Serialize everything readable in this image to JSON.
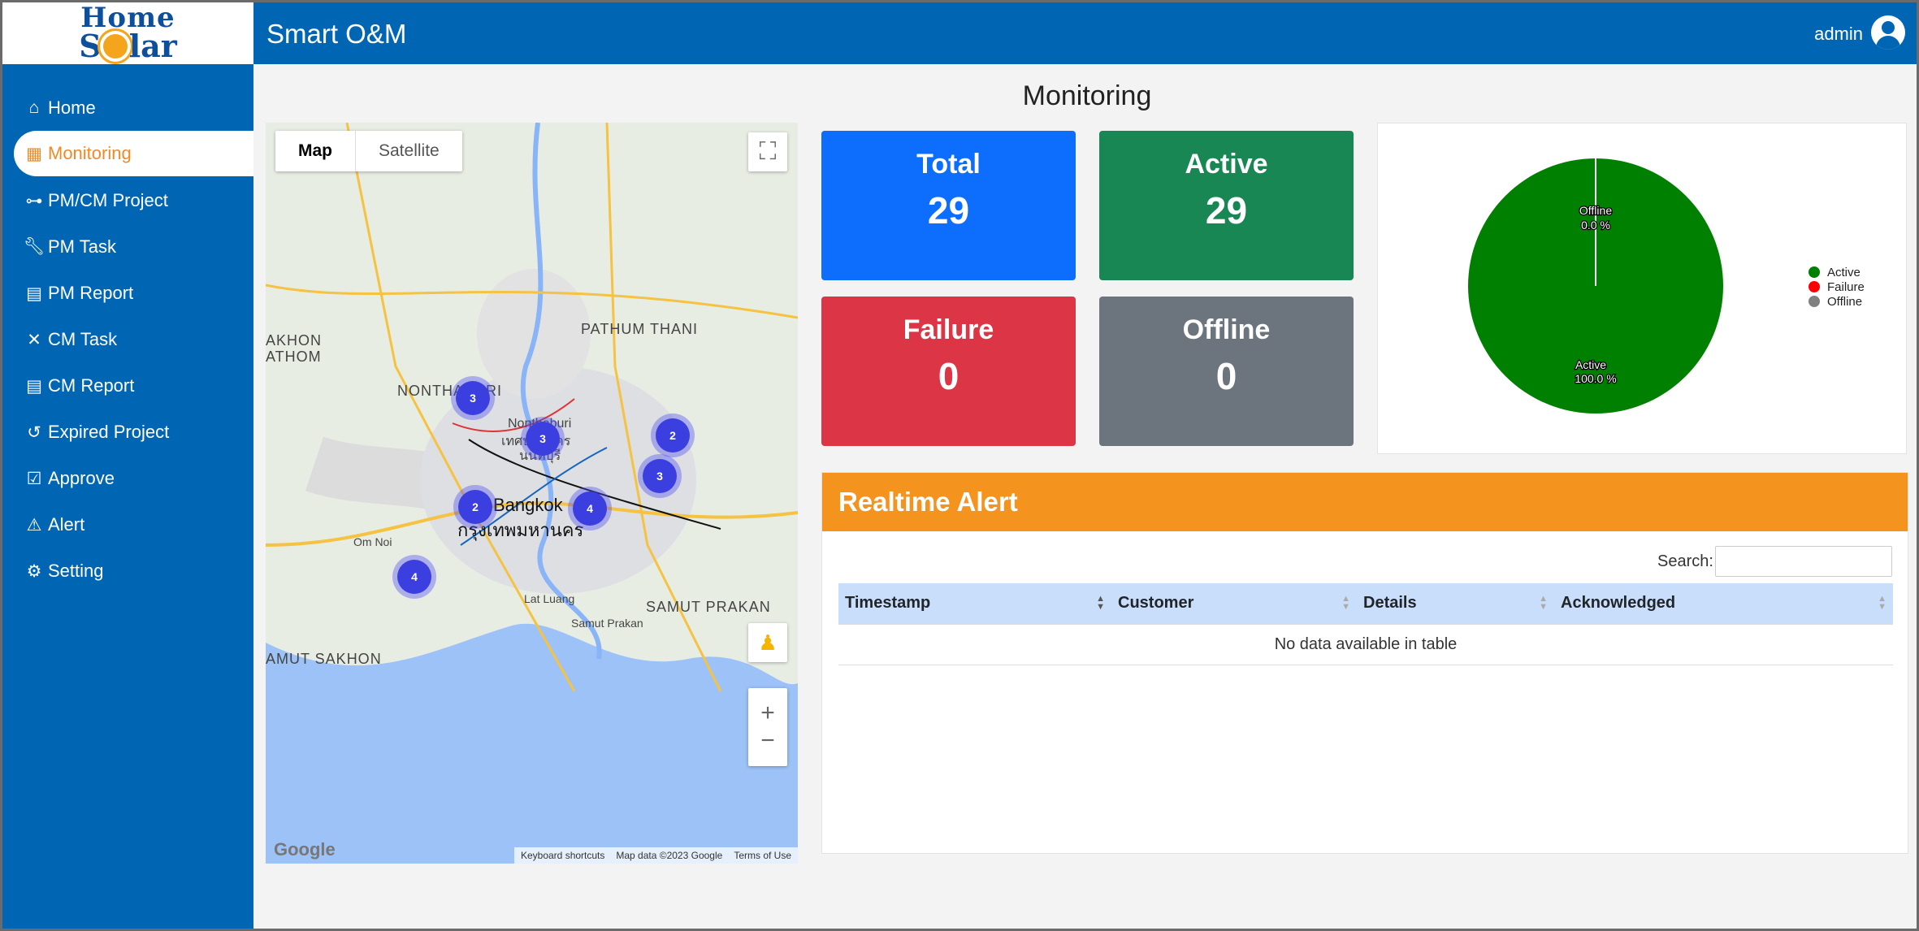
{
  "brand": {
    "logo_top": "Home",
    "logo_bottom_left": "S",
    "logo_bottom_right": "lar"
  },
  "header": {
    "title": "Smart O&M",
    "user": "admin"
  },
  "sidebar": {
    "items": [
      {
        "label": "Home",
        "icon": "home-icon"
      },
      {
        "label": "Monitoring",
        "icon": "map-icon",
        "active": true
      },
      {
        "label": "PM/CM Project",
        "icon": "sitemap-icon"
      },
      {
        "label": "PM Task",
        "icon": "wrench-icon"
      },
      {
        "label": "PM Report",
        "icon": "report-icon"
      },
      {
        "label": "CM Task",
        "icon": "tools-icon"
      },
      {
        "label": "CM Report",
        "icon": "report-icon"
      },
      {
        "label": "Expired Project",
        "icon": "history-icon"
      },
      {
        "label": "Approve",
        "icon": "check-icon"
      },
      {
        "label": "Alert",
        "icon": "warning-icon"
      },
      {
        "label": "Setting",
        "icon": "gears-icon"
      }
    ]
  },
  "page": {
    "title": "Monitoring"
  },
  "map": {
    "type_map": "Map",
    "type_satellite": "Satellite",
    "zoom_in": "+",
    "zoom_out": "−",
    "labels": [
      "PATHUM THANI",
      "NONTHABURI",
      "Nonthaburi",
      "เทศบาลนคร",
      "นนทบุรี",
      "Bangkok",
      "กรุงเทพมหานคร",
      "SAMUT PRAKAN",
      "Samut Prakan",
      "AKHON",
      "ATHOM",
      "AMUT SAKHON",
      "Om Noi",
      "Lat Luang"
    ],
    "clusters": [
      "3",
      "3",
      "2",
      "3",
      "2",
      "4",
      "4"
    ],
    "google": "Google",
    "footer": [
      "Keyboard shortcuts",
      "Map data ©2023 Google",
      "Terms of Use"
    ]
  },
  "stats": {
    "total": {
      "label": "Total",
      "value": "29",
      "color": "#0d6efd"
    },
    "active": {
      "label": "Active",
      "value": "29",
      "color": "#198754"
    },
    "failure": {
      "label": "Failure",
      "value": "0",
      "color": "#dc3545"
    },
    "offline": {
      "label": "Offline",
      "value": "0",
      "color": "#6c757d"
    }
  },
  "pie": {
    "slices": [
      {
        "label": "Active",
        "percent": 100.0,
        "text": "Active",
        "pct_text": "100.0 %",
        "color": "#008000"
      },
      {
        "label": "Failure",
        "percent": 0.0,
        "color": "#ff0000"
      },
      {
        "label": "Offline",
        "percent": 0.0,
        "text": "Offline",
        "pct_text": "0.0 %",
        "color": "#808080"
      }
    ]
  },
  "alert": {
    "title": "Realtime Alert",
    "search_label": "Search:",
    "columns": [
      "Timestamp",
      "Customer",
      "Details",
      "Acknowledged"
    ],
    "empty": "No data available in table"
  }
}
